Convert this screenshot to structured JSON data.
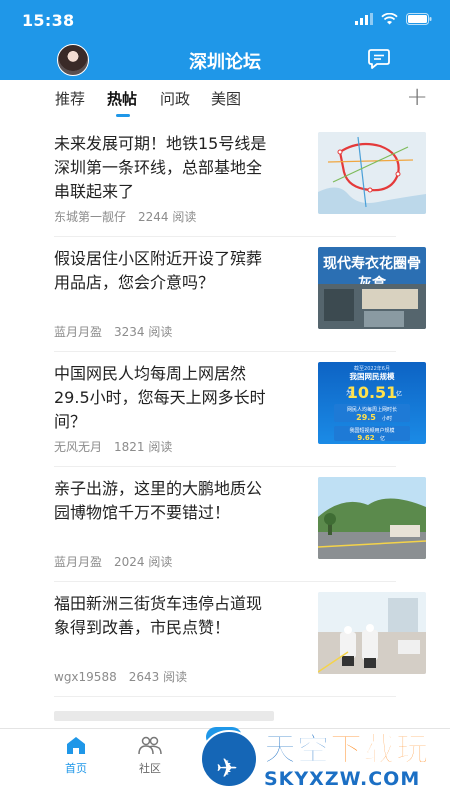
{
  "status_bar": {
    "time": "15:38"
  },
  "header": {
    "title": "深圳论坛"
  },
  "tabs": [
    {
      "label": "推荐"
    },
    {
      "label": "热帖"
    },
    {
      "label": "问政"
    },
    {
      "label": "美图"
    }
  ],
  "tabs_add_label": "+",
  "posts": [
    {
      "title": "未来发展可期！地铁15号线是深圳第一条环线，总部基地全串联起来了",
      "author": "东城第一靓仔",
      "views": "2244 阅读",
      "thumb": "metro-map-image"
    },
    {
      "title": "假设居住小区附近开设了殡葬用品店，您会介意吗？",
      "author": "蓝月月盈",
      "views": "3234 阅读",
      "thumb": "shop-sign-image",
      "thumb_text": "现代寿衣花圈骨灰盒"
    },
    {
      "title": "中国网民人均每周上网居然29.5小时，您每天上网多长时间？",
      "author": "无风无月",
      "views": "1821 阅读",
      "thumb": "internet-stats-image",
      "thumb_lines": [
        "截至2022年6月",
        "我国网民规模",
        "为",
        "10.51",
        "亿",
        "网民人均每周上网时长",
        "29.5",
        "小时",
        "我国短视频用户规模",
        "9.62",
        "亿"
      ]
    },
    {
      "title": "亲子出游，这里的大鹏地质公园博物馆千万不要错过！",
      "author": "蓝月月盈",
      "views": "2024 阅读",
      "thumb": "park-museum-image"
    },
    {
      "title": "福田新洲三街货车违停占道现象得到改善，市民点赞！",
      "author": "wgx19588",
      "views": "2643 阅读",
      "thumb": "police-street-image"
    }
  ],
  "bottom_nav": [
    {
      "label": "首页",
      "icon": "home-icon",
      "active": true
    },
    {
      "label": "社区",
      "icon": "community-icon",
      "active": false
    }
  ],
  "watermark": {
    "title_main": "天空",
    "title_accent": "下载玩",
    "subtitle": "SKYXZW.COM"
  },
  "colors": {
    "primary": "#1f97e8",
    "text": "#222222",
    "meta": "#8c8c8c"
  }
}
